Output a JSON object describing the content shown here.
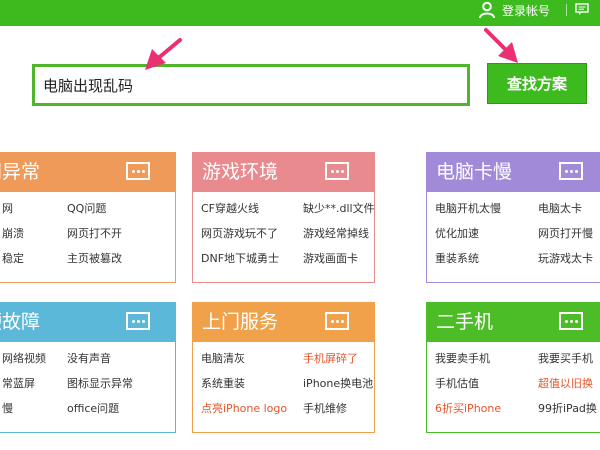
{
  "header": {
    "login_label": "登录帐号",
    "bar_color": "#3dba1e"
  },
  "search": {
    "value": "电脑出现乱码",
    "button_label": "查找方案"
  },
  "panels": [
    {
      "title": "网异常",
      "color": "#f09a5a",
      "links": [
        "网",
        "QQ问题",
        "崩溃",
        "网页打不开",
        "稳定",
        "主页被篡改"
      ]
    },
    {
      "title": "游戏环境",
      "color": "#e98a8e",
      "links": [
        "CF穿越火线",
        "缺少**.dll文件",
        "网页游戏玩不了",
        "游戏经常掉线",
        "DNF地下城勇士",
        "游戏画面卡"
      ]
    },
    {
      "title": "电脑卡慢",
      "color": "#a18ad8",
      "links": [
        "电脑开机太慢",
        "电脑太卡",
        "优化加速",
        "网页打开慢",
        "重装系统",
        "玩游戏太卡"
      ]
    },
    {
      "title": "硬故障",
      "color": "#5cb8d8",
      "links": [
        "网络视频",
        "没有声音",
        "常蓝屏",
        "图标显示异常",
        "慢",
        "office问题"
      ]
    },
    {
      "title": "上门服务",
      "color": "#f0a14a",
      "links": [
        "电脑清灰",
        "手机屏碎了",
        "系统重装",
        "iPhone换电池",
        "点亮iPhone logo",
        "手机维修"
      ]
    },
    {
      "title": "二手机",
      "color": "#4cbd27",
      "links": [
        "我要卖手机",
        "我要买手机",
        "手机估值",
        "超值以旧换",
        "6折买iPhone",
        "99折iPad换"
      ]
    }
  ]
}
